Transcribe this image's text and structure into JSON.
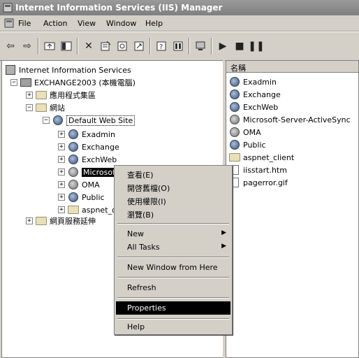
{
  "window": {
    "title": "Internet Information Services (IIS) Manager"
  },
  "menu": {
    "file": "File",
    "action": "Action",
    "view": "View",
    "window": "Window",
    "help": "Help"
  },
  "toolbar": {
    "icons": [
      "back-icon",
      "forward-icon",
      "up-icon",
      "show-hide-tree-icon",
      "delete-icon",
      "properties-icon",
      "refresh-icon",
      "export-icon",
      "help-icon",
      "console-icon",
      "computer-icon",
      "play-icon",
      "stop-icon",
      "pause-icon"
    ]
  },
  "tree": {
    "root": "Internet Information Services",
    "server": "EXCHANGE2003 (本機電腦)",
    "app_pools": "應用程式集區",
    "web_sites": "網站",
    "default_site": "Default Web Site",
    "children": [
      "Exadmin",
      "Exchange",
      "ExchWeb",
      "Microsoft-Server-ActiveSync",
      "OMA",
      "Public",
      "aspnet_client"
    ],
    "web_ext": "網頁服務延伸"
  },
  "list": {
    "header": "名稱",
    "items": [
      "Exadmin",
      "Exchange",
      "ExchWeb",
      "Microsoft-Server-ActiveSync",
      "OMA",
      "Public",
      "aspnet_client",
      "iisstart.htm",
      "pagerror.gif"
    ]
  },
  "context_menu": {
    "items": [
      "查看(E)",
      "開啓舊檔(O)",
      "使用權限(I)",
      "瀏覽(B)",
      "New",
      "All Tasks",
      "New Window from Here",
      "Refresh",
      "Properties",
      "Help"
    ],
    "highlighted": "Properties"
  },
  "colors": {
    "titlebar": "#8a8a8a",
    "face": "#d4d0c8",
    "highlight": "#000000"
  }
}
